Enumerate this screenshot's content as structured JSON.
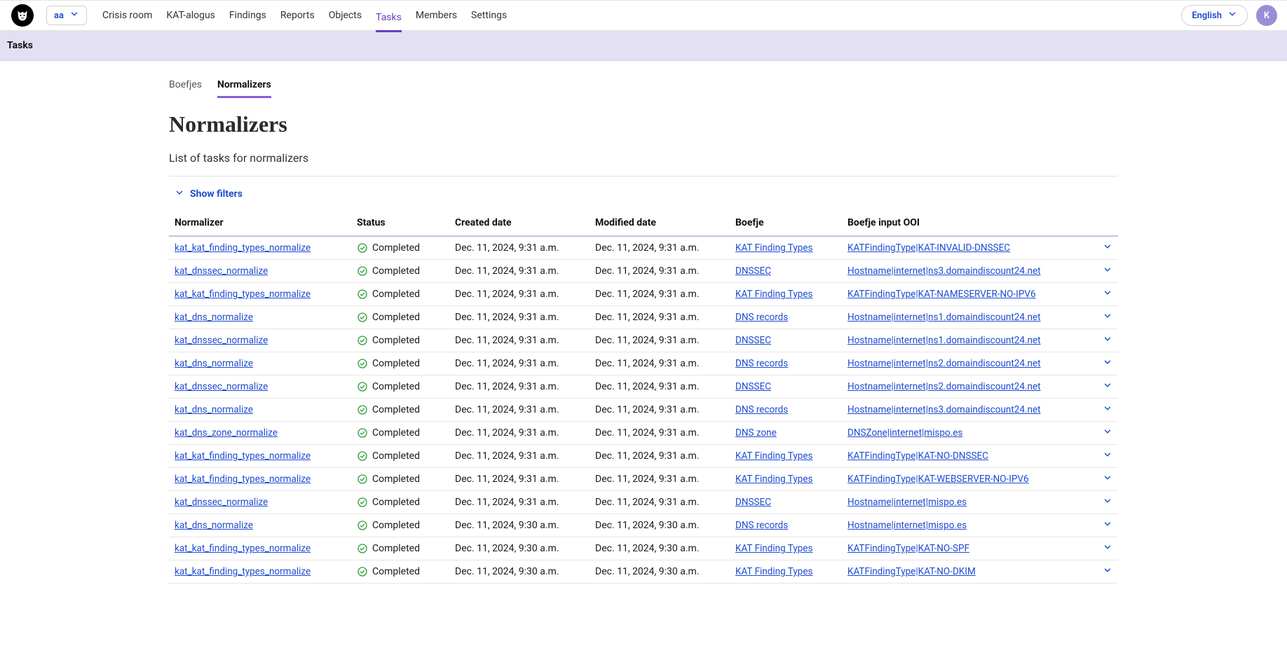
{
  "header": {
    "org": "aa",
    "nav": [
      {
        "label": "Crisis room",
        "active": false
      },
      {
        "label": "KAT-alogus",
        "active": false
      },
      {
        "label": "Findings",
        "active": false
      },
      {
        "label": "Reports",
        "active": false
      },
      {
        "label": "Objects",
        "active": false
      },
      {
        "label": "Tasks",
        "active": true
      },
      {
        "label": "Members",
        "active": false
      },
      {
        "label": "Settings",
        "active": false
      }
    ],
    "language": "English",
    "avatar_initial": "K"
  },
  "breadcrumb": "Tasks",
  "subtabs": [
    {
      "label": "Boefjes",
      "active": false
    },
    {
      "label": "Normalizers",
      "active": true
    }
  ],
  "page_title": "Normalizers",
  "subtitle": "List of tasks for normalizers",
  "show_filters_label": "Show filters",
  "table": {
    "columns": {
      "normalizer": "Normalizer",
      "status": "Status",
      "created": "Created date",
      "modified": "Modified date",
      "boefje": "Boefje",
      "ooi": "Boefje input OOI"
    },
    "status_completed": "Completed",
    "rows": [
      {
        "normalizer": "kat_kat_finding_types_normalize",
        "created": "Dec. 11, 2024, 9:31 a.m.",
        "modified": "Dec. 11, 2024, 9:31 a.m.",
        "boefje": "KAT Finding Types",
        "ooi": "KATFindingType|KAT-INVALID-DNSSEC"
      },
      {
        "normalizer": "kat_dnssec_normalize",
        "created": "Dec. 11, 2024, 9:31 a.m.",
        "modified": "Dec. 11, 2024, 9:31 a.m.",
        "boefje": "DNSSEC",
        "ooi": "Hostname|internet|ns3.domaindiscount24.net"
      },
      {
        "normalizer": "kat_kat_finding_types_normalize",
        "created": "Dec. 11, 2024, 9:31 a.m.",
        "modified": "Dec. 11, 2024, 9:31 a.m.",
        "boefje": "KAT Finding Types",
        "ooi": "KATFindingType|KAT-NAMESERVER-NO-IPV6"
      },
      {
        "normalizer": "kat_dns_normalize",
        "created": "Dec. 11, 2024, 9:31 a.m.",
        "modified": "Dec. 11, 2024, 9:31 a.m.",
        "boefje": "DNS records",
        "ooi": "Hostname|internet|ns1.domaindiscount24.net"
      },
      {
        "normalizer": "kat_dnssec_normalize",
        "created": "Dec. 11, 2024, 9:31 a.m.",
        "modified": "Dec. 11, 2024, 9:31 a.m.",
        "boefje": "DNSSEC",
        "ooi": "Hostname|internet|ns1.domaindiscount24.net"
      },
      {
        "normalizer": "kat_dns_normalize",
        "created": "Dec. 11, 2024, 9:31 a.m.",
        "modified": "Dec. 11, 2024, 9:31 a.m.",
        "boefje": "DNS records",
        "ooi": "Hostname|internet|ns2.domaindiscount24.net"
      },
      {
        "normalizer": "kat_dnssec_normalize",
        "created": "Dec. 11, 2024, 9:31 a.m.",
        "modified": "Dec. 11, 2024, 9:31 a.m.",
        "boefje": "DNSSEC",
        "ooi": "Hostname|internet|ns2.domaindiscount24.net"
      },
      {
        "normalizer": "kat_dns_normalize",
        "created": "Dec. 11, 2024, 9:31 a.m.",
        "modified": "Dec. 11, 2024, 9:31 a.m.",
        "boefje": "DNS records",
        "ooi": "Hostname|internet|ns3.domaindiscount24.net"
      },
      {
        "normalizer": "kat_dns_zone_normalize",
        "created": "Dec. 11, 2024, 9:31 a.m.",
        "modified": "Dec. 11, 2024, 9:31 a.m.",
        "boefje": "DNS zone",
        "ooi": "DNSZone|internet|mispo.es"
      },
      {
        "normalizer": "kat_kat_finding_types_normalize",
        "created": "Dec. 11, 2024, 9:31 a.m.",
        "modified": "Dec. 11, 2024, 9:31 a.m.",
        "boefje": "KAT Finding Types",
        "ooi": "KATFindingType|KAT-NO-DNSSEC"
      },
      {
        "normalizer": "kat_kat_finding_types_normalize",
        "created": "Dec. 11, 2024, 9:31 a.m.",
        "modified": "Dec. 11, 2024, 9:31 a.m.",
        "boefje": "KAT Finding Types",
        "ooi": "KATFindingType|KAT-WEBSERVER-NO-IPV6"
      },
      {
        "normalizer": "kat_dnssec_normalize",
        "created": "Dec. 11, 2024, 9:31 a.m.",
        "modified": "Dec. 11, 2024, 9:31 a.m.",
        "boefje": "DNSSEC",
        "ooi": "Hostname|internet|mispo.es"
      },
      {
        "normalizer": "kat_dns_normalize",
        "created": "Dec. 11, 2024, 9:30 a.m.",
        "modified": "Dec. 11, 2024, 9:30 a.m.",
        "boefje": "DNS records",
        "ooi": "Hostname|internet|mispo.es"
      },
      {
        "normalizer": "kat_kat_finding_types_normalize",
        "created": "Dec. 11, 2024, 9:30 a.m.",
        "modified": "Dec. 11, 2024, 9:30 a.m.",
        "boefje": "KAT Finding Types",
        "ooi": "KATFindingType|KAT-NO-SPF"
      },
      {
        "normalizer": "kat_kat_finding_types_normalize",
        "created": "Dec. 11, 2024, 9:30 a.m.",
        "modified": "Dec. 11, 2024, 9:30 a.m.",
        "boefje": "KAT Finding Types",
        "ooi": "KATFindingType|KAT-NO-DKIM"
      }
    ]
  }
}
